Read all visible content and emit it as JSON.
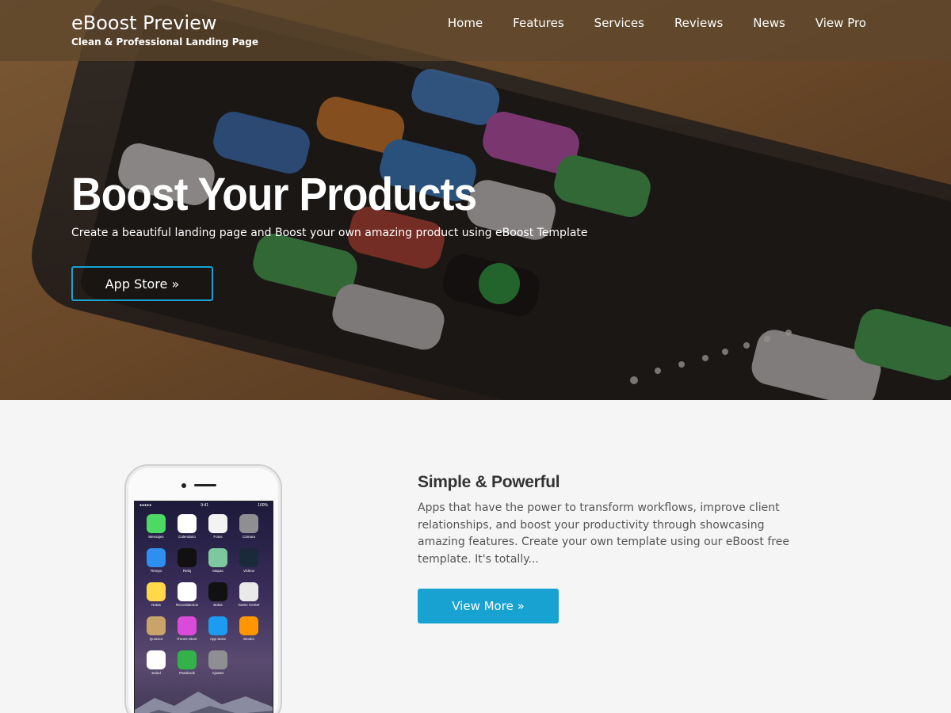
{
  "header": {
    "brand_title": "eBoost Preview",
    "brand_subtitle": "Clean & Professional Landing Page",
    "nav": [
      "Home",
      "Features",
      "Services",
      "Reviews",
      "News",
      "View Pro"
    ]
  },
  "hero": {
    "title": "Boost Your Products",
    "subtitle": "Create a beautiful landing page and Boost your own amazing product using eBoost Template",
    "button_label": "App Store »"
  },
  "feature": {
    "title": "Simple & Powerful",
    "text": "Apps that have the power to transform workflows, improve client relationships, and boost your productivity through showcasing amazing features. Create your own template using our eBoost free template. It's totally...",
    "button_label": "View More »"
  },
  "phone": {
    "time": "9:41",
    "battery": "100%",
    "apps": [
      {
        "label": "Mensajes",
        "color": "#4cd964"
      },
      {
        "label": "Calendario",
        "color": "#ffffff"
      },
      {
        "label": "Fotos",
        "color": "#f3f3f3"
      },
      {
        "label": "Cámara",
        "color": "#8e8e93"
      },
      {
        "label": "Tiempo",
        "color": "#2f8ff0"
      },
      {
        "label": "Reloj",
        "color": "#111111"
      },
      {
        "label": "Mapas",
        "color": "#7ec8a0"
      },
      {
        "label": "Vídeos",
        "color": "#1a2a3a"
      },
      {
        "label": "Notas",
        "color": "#ffd94a"
      },
      {
        "label": "Recordatorios",
        "color": "#ffffff"
      },
      {
        "label": "Bolsa",
        "color": "#111111"
      },
      {
        "label": "Game Center",
        "color": "#e9e9e9"
      },
      {
        "label": "Quiosco",
        "color": "#c8a46a"
      },
      {
        "label": "iTunes Store",
        "color": "#d94bd8"
      },
      {
        "label": "App Store",
        "color": "#1d9bf0"
      },
      {
        "label": "iBooks",
        "color": "#ff9500"
      },
      {
        "label": "Salud",
        "color": "#ffffff"
      },
      {
        "label": "Passbook",
        "color": "#33b24a"
      },
      {
        "label": "Ajustes",
        "color": "#8e8e93"
      }
    ]
  },
  "colors": {
    "accent": "#17a2d2",
    "topbar": "#5f462d",
    "section_bg": "#f5f5f5"
  }
}
